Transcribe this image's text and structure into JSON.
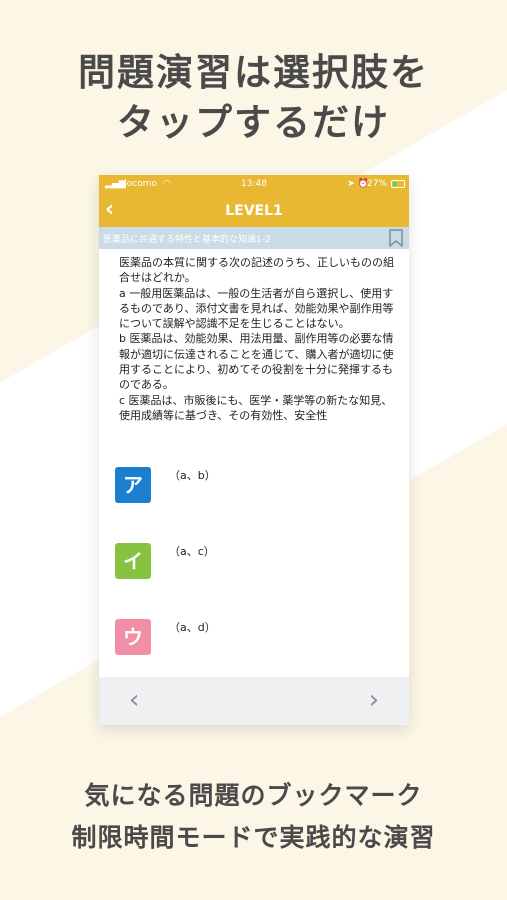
{
  "headline": {
    "line1": "問題演習は選択肢を",
    "line2": "タップするだけ"
  },
  "status_bar": {
    "carrier": "docomo",
    "time": "13:48",
    "battery": "27%"
  },
  "nav": {
    "back_icon": "chevron-left-icon",
    "title": "LEVEL1"
  },
  "category": {
    "label": "医薬品に共通する特性と基本的な知識1-2",
    "bookmark_icon": "bookmark-icon"
  },
  "question": {
    "lines": [
      "医薬品の本質に関する次の記述のうち、正しいものの組合せはどれか。",
      "a 一般用医薬品は、一般の生活者が自ら選択し、使用するものであり、添付文書を見れば、効能効果や副作用等について誤解や認識不足を生じることはない。",
      "b 医薬品は、効能効果、用法用量、副作用等の必要な情報が適切に伝達されることを通じて、購入者が適切に使用することにより、初めてその役割を十分に発揮するものである。",
      "c 医薬品は、市販後にも、医学・薬学等の新たな知見、使用成績等に基づき、その有効性、安全性"
    ]
  },
  "choices": [
    {
      "badge": "ア",
      "text": "（a、b）",
      "color": "#1a7fcf"
    },
    {
      "badge": "イ",
      "text": "（a、c）",
      "color": "#86c340"
    },
    {
      "badge": "ウ",
      "text": "（a、d）",
      "color": "#f28fa6"
    }
  ],
  "bottom_nav": {
    "prev": "‹",
    "next": "›"
  },
  "footer": {
    "line1": "気になる問題のブックマーク",
    "line2": "制限時間モードで実践的な演習"
  },
  "colors": {
    "accent": "#e8b833",
    "category_bg": "#c9dbe4"
  }
}
